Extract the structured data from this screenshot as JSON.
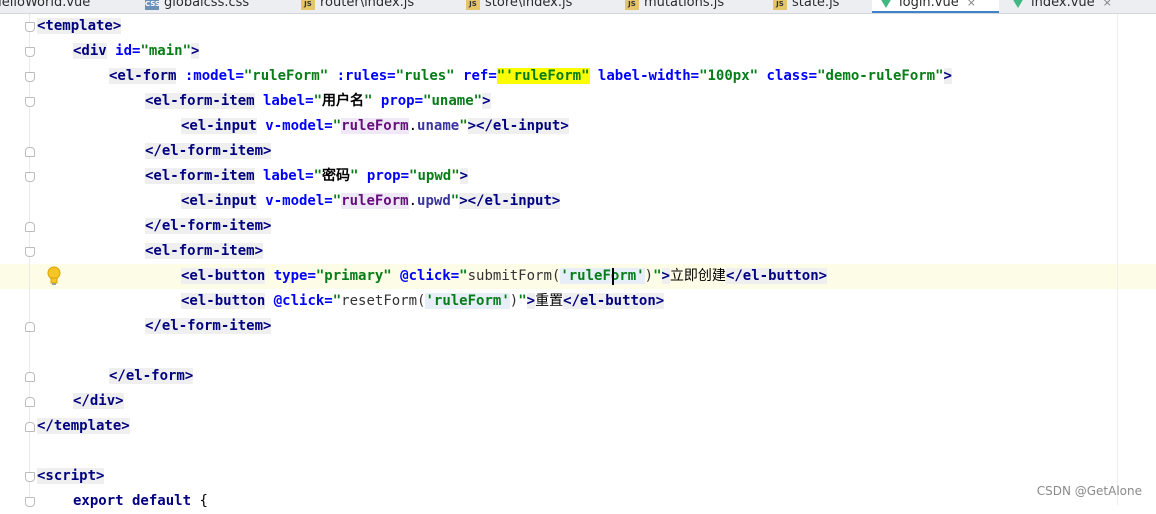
{
  "tabs": [
    {
      "label": "HelloWorld.vue",
      "type": "vue"
    },
    {
      "label": "globalcss.css",
      "type": "css"
    },
    {
      "label": "router\\index.js",
      "type": "js"
    },
    {
      "label": "store\\index.js",
      "type": "js"
    },
    {
      "label": "mutations.js",
      "type": "js"
    },
    {
      "label": "state.js",
      "type": "js"
    },
    {
      "label": "login.vue",
      "type": "vue",
      "active": true
    },
    {
      "label": "index.vue",
      "type": "vue"
    }
  ],
  "code": {
    "l1": {
      "open": "<template>"
    },
    "l2": {
      "tag": "<div",
      "attr": " id=",
      "val": "\"main\"",
      "close": ">"
    },
    "l3": {
      "tag": "<el-form",
      "a1": " :model=",
      "v1": "\"ruleForm\"",
      "a2": " :rules=",
      "v2": "\"rules\"",
      "a3": " ref=",
      "v3": "\"'ruleForm\"",
      "a4": " label-width=",
      "v4": "\"100px\"",
      "a5": " class=",
      "v5": "\"demo-ruleForm\"",
      "close": ">"
    },
    "l4": {
      "tag": "<el-form-item",
      "a1": " label=",
      "v1q1": "\"",
      "v1": "用户名",
      "v1q2": "\"",
      "a2": " prop=",
      "v2": "\"uname\"",
      "close": ">"
    },
    "l5": {
      "tag": "<el-input",
      "a1": " v-model=",
      "q1": "\"",
      "obj": "ruleForm",
      "dot": ".",
      "prop": "uname",
      "q2": "\"",
      "mid": "></",
      "endtag": "el-input",
      "close": ">"
    },
    "l6": {
      "text": "</el-form-item>"
    },
    "l7": {
      "tag": "<el-form-item",
      "a1": " label=",
      "v1q1": "\"",
      "v1": "密码",
      "v1q2": "\"",
      "a2": " prop=",
      "v2": "\"upwd\"",
      "close": ">"
    },
    "l8": {
      "tag": "<el-input",
      "a1": " v-model=",
      "q1": "\"",
      "obj": "ruleForm",
      "dot": ".",
      "prop": "upwd",
      "q2": "\"",
      "mid": "></",
      "endtag": "el-input",
      "close": ">"
    },
    "l9": {
      "text": "</el-form-item>"
    },
    "l10": {
      "text": "<el-form-item>"
    },
    "l11": {
      "tag": "<el-button",
      "a1": " type=",
      "v1": "\"primary\"",
      "a2": " @click=",
      "q1": "\"",
      "fn": "submitForm(",
      "arg": "'ruleForm'",
      "fnc": ")",
      "q2": "\"",
      "close": ">",
      "text": "立即创建",
      "end": "</el-button>"
    },
    "l12": {
      "tag": "<el-button",
      "a1": " @click=",
      "q1": "\"",
      "fn": "resetForm(",
      "arg": "'ruleForm'",
      "fnc": ")",
      "q2": "\"",
      "close": ">",
      "text": "重置",
      "end": "</el-button>"
    },
    "l13": {
      "text": "</el-form-item>"
    },
    "l15": {
      "text": "</el-form>"
    },
    "l16": {
      "text": "</div>"
    },
    "l17": {
      "text": "</template>"
    },
    "l19": {
      "text": "<script>"
    },
    "l20": {
      "kw": "export default",
      "rest": " {"
    }
  },
  "watermark": "CSDN @GetAlone"
}
